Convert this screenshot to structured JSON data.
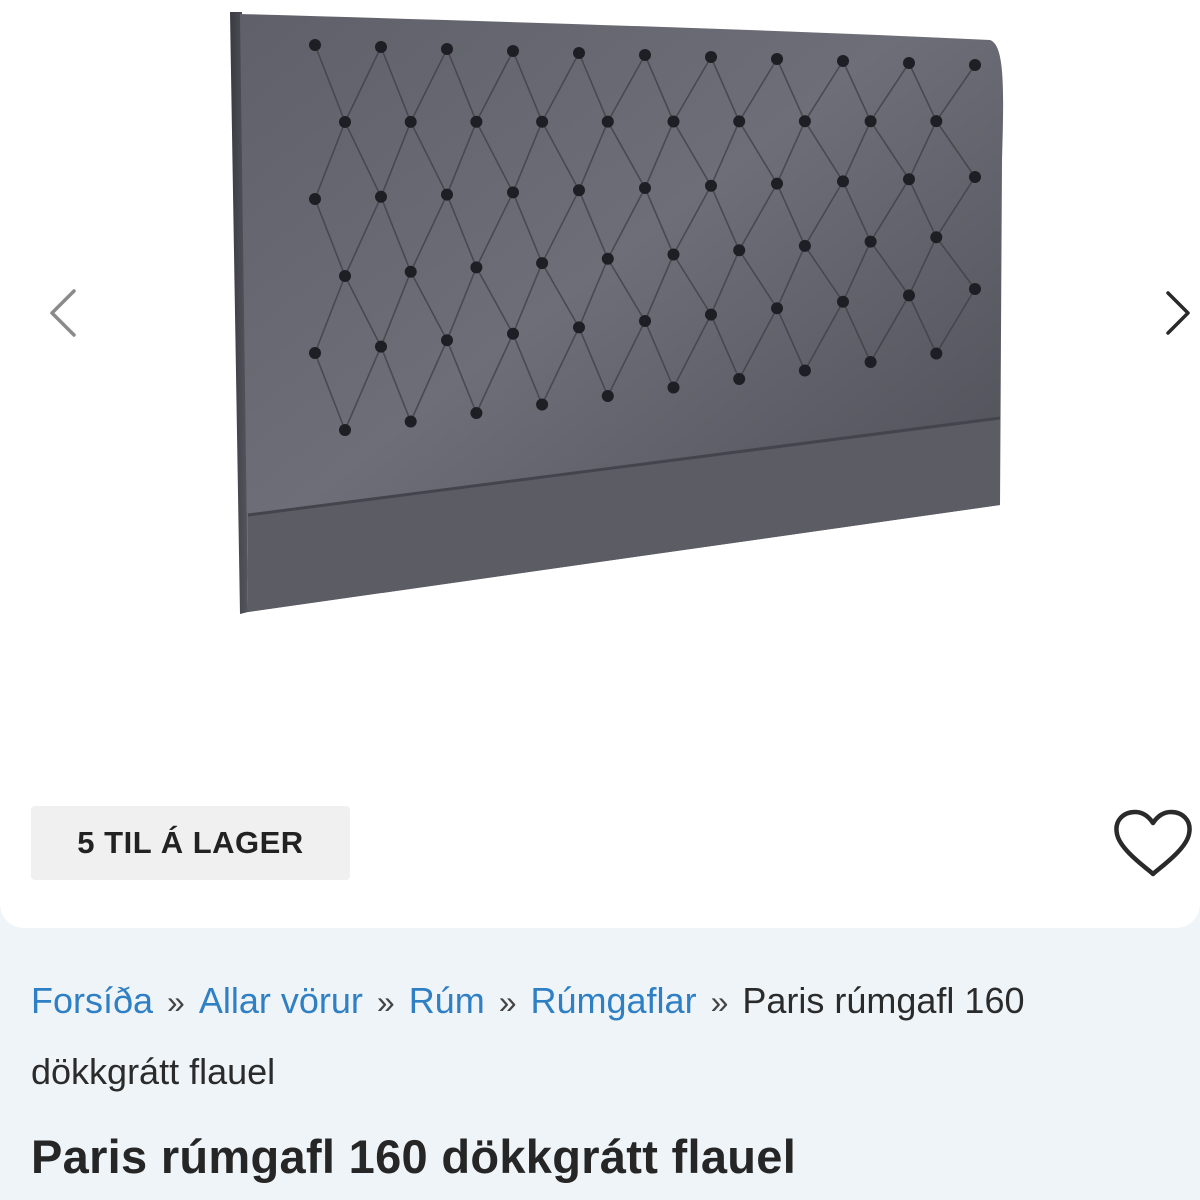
{
  "gallery": {
    "prev_icon": "chevron-left-icon",
    "next_icon": "chevron-right-icon",
    "product_image_alt": "",
    "stock_badge": "5 TIL Á LAGER",
    "wishlist_icon": "heart-outline-icon"
  },
  "breadcrumb": {
    "items": [
      "Forsíða",
      "Allar vörur",
      "Rúm",
      "Rúmgaflar"
    ],
    "separator": "»",
    "current": "Paris rúmgafl 160 dökkgrátt flauel"
  },
  "product": {
    "title": "Paris rúmgafl 160 dökkgrátt flauel"
  },
  "colors": {
    "link": "#2f7fc4",
    "badge_bg": "#f0f0f0",
    "page_bg": "#eef4f8",
    "velvet": "#55565e"
  }
}
